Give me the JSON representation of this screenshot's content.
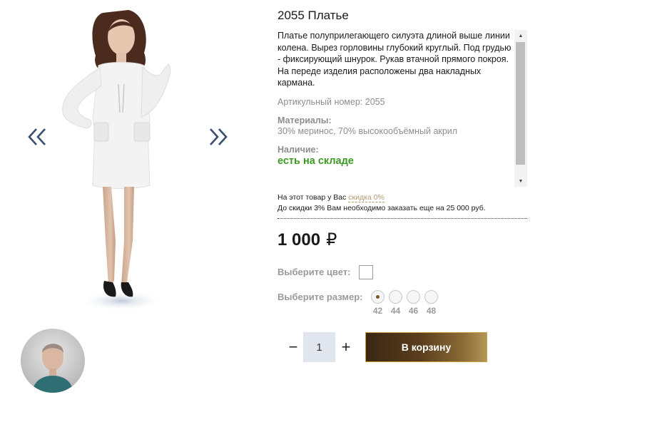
{
  "gallery": {
    "prev_icon": "double-chevron-left-icon",
    "next_icon": "double-chevron-right-icon",
    "main_image": "model-in-white-dress",
    "thumbnail": "mannequin-head-thumbnail"
  },
  "product": {
    "title": "2055 Платье",
    "description": "Платье полуприлегающего силуэта длиной выше линии колена. Вырез горловины глубокий круглый. Под грудью - фиксирующий шнурок. Рукав втачной прямого покроя. На переде изделия расположены два накладных кармана.",
    "article": "Артикульный номер: 2055",
    "materials_label": "Материалы:",
    "materials_value": "30% меринос, 70% высокообъёмный акрил",
    "availability_label": "Наличие:",
    "availability_value": "есть на складе"
  },
  "discount": {
    "line1_prefix": "На этот товар у Вас",
    "line1_link": "скидка 0%",
    "line2": "До скидки 3% Вам необходимо заказать еще на 25 000 руб."
  },
  "price": {
    "amount": "1 000",
    "currency": "₽"
  },
  "options": {
    "color_label": "Выберите цвет:",
    "size_label": "Выберите размер:",
    "sizes": [
      "42",
      "44",
      "46",
      "48"
    ],
    "selected_size": "42"
  },
  "cart": {
    "minus": "−",
    "plus": "+",
    "quantity": "1",
    "button_label": "В корзину"
  },
  "colors": {
    "accent_brown": "#5a3d1c",
    "stock_green": "#3c9a23",
    "arrow_blue": "#3a4e70"
  }
}
